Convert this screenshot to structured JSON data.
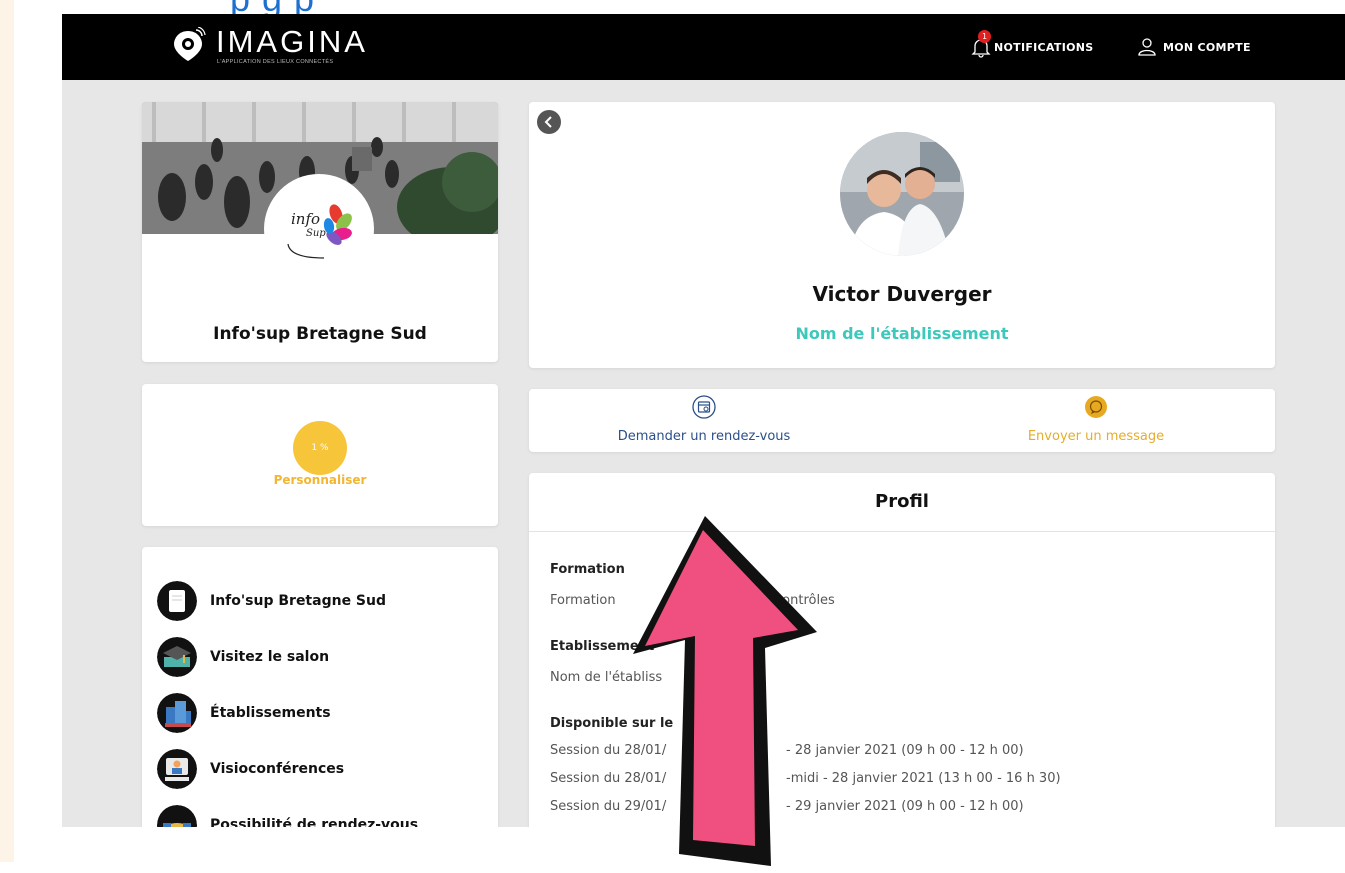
{
  "caption": {
    "text": "p                       g                                    p"
  },
  "nav": {
    "brand": "IMAGINA",
    "brand_tagline": "L'APPLICATION DES LIEUX CONNECTÉS",
    "notifications_label": "NOTIFICATIONS",
    "notifications_count": "1",
    "account_label": "MON COMPTE"
  },
  "org": {
    "name": "Info'sup Bretagne Sud"
  },
  "progress": {
    "percent_label": "1 %",
    "percent_value": 1,
    "action_label": "Personnaliser"
  },
  "menu": {
    "items": [
      {
        "label": "Info'sup Bretagne Sud",
        "icon": "document-icon"
      },
      {
        "label": "Visitez le salon",
        "icon": "graduation-cap-icon"
      },
      {
        "label": "Établissements",
        "icon": "buildings-icon"
      },
      {
        "label": "Visioconférences",
        "icon": "video-conference-icon"
      },
      {
        "label": "Possibilité de rendez-vous",
        "icon": "handshake-icon"
      }
    ]
  },
  "profile": {
    "name": "Victor Duverger",
    "establishment": "Nom de l'établissement"
  },
  "actions": {
    "appointment_label": "Demander un rendez-vous",
    "message_label": "Envoyer un message"
  },
  "info": {
    "title": "Profil",
    "formation_title": "Formation",
    "formation_value_start": "Formation",
    "formation_value_end": "contrôles",
    "establishment_title": "Etablissement",
    "establishment_value": "Nom de l'établiss",
    "availability_title": "Disponible sur le",
    "sessions": [
      {
        "start": "Session du 28/01/",
        "end": "- 28 janvier 2021 (09 h 00 - 12 h 00)"
      },
      {
        "start": "Session du 28/01/",
        "end": "-midi - 28 janvier 2021 (13 h 00 - 16 h 30)"
      },
      {
        "start": "Session du 29/01/",
        "end": "- 29 janvier 2021 (09 h 00 - 12 h 00)"
      }
    ]
  },
  "colors": {
    "nav_bg": "#000000",
    "accent_teal": "#3cc8bb",
    "accent_yellow": "#f7c53a",
    "action_blue": "#2b4f8a",
    "action_gold": "#e3ad2d",
    "arrow_pink": "#f0507f",
    "caption_blue": "#1d6fd0"
  }
}
